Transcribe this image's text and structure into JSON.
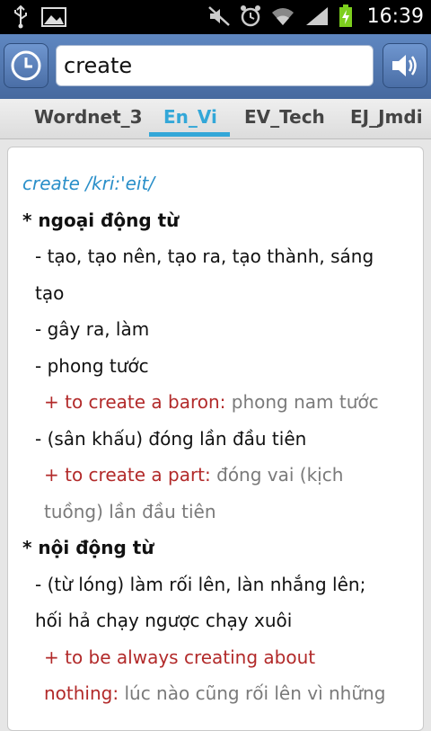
{
  "status_bar": {
    "time": "16:39",
    "icons": [
      "usb-icon",
      "image-icon",
      "mute-icon",
      "alarm-icon",
      "wifi-icon",
      "signal-icon",
      "battery-charging-icon"
    ]
  },
  "search": {
    "value": "create",
    "history_button": "history-clock-icon",
    "speak_button": "speaker-icon"
  },
  "tabs": [
    "Wordnet_3",
    "En_Vi",
    "EV_Tech",
    "EJ_Jmdi"
  ],
  "active_tab": "En_Vi",
  "entry": {
    "headword": "create /kri:'eit/",
    "lines": [
      {
        "type": "pos",
        "text": "* ngoại động từ"
      },
      {
        "type": "def",
        "text": "- tạo, tạo nên, tạo ra, tạo thành, sáng"
      },
      {
        "type": "cont",
        "text": "tạo"
      },
      {
        "type": "def",
        "text": "- gây ra, làm"
      },
      {
        "type": "def",
        "text": "- phong tước"
      },
      {
        "type": "ex",
        "en": "+ to create a baron:",
        "vi": "phong nam tước"
      },
      {
        "type": "def",
        "text": "- (sân khấu) đóng lần đầu tiên"
      },
      {
        "type": "ex",
        "en": "+ to create a part:",
        "vi": "đóng vai (kịch"
      },
      {
        "type": "ex_cont",
        "vi": "tuồng) lần đầu tiên"
      },
      {
        "type": "pos",
        "text": "* nội động từ"
      },
      {
        "type": "def",
        "text": "- (từ lóng) làm rối lên, làn nhắng lên;"
      },
      {
        "type": "cont",
        "text": "hối hả chạy ngược chạy xuôi"
      },
      {
        "type": "ex_en_only",
        "en": "+ to be always creating about"
      },
      {
        "type": "ex",
        "en": "nothing:",
        "vi": "lúc nào cũng rối lên vì những"
      }
    ]
  },
  "colors": {
    "accent": "#33a7d8",
    "headword": "#2a8fc9",
    "example_en": "#b22a2a",
    "example_vi": "#7a7a7a",
    "search_bar": "#5178b3"
  }
}
